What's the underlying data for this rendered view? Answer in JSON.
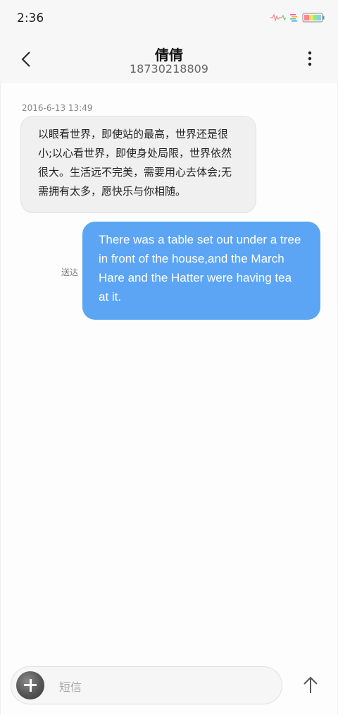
{
  "status_bar": {
    "time": "2:36"
  },
  "header": {
    "name": "倩倩",
    "number": "18730218809"
  },
  "messages": {
    "incoming": {
      "timestamp": "2016-6-13 13:49",
      "text": "以眼看世界，即使站的最高，世界还是很小;以心看世界，即使身处局限，世界依然很大。生活远不完美，需要用心去体会;无需拥有太多，愿快乐与你相随。"
    },
    "outgoing": {
      "status": "送达",
      "text": "There was a table set out under a tree in front of the house,and the March Hare and the Hatter were having tea at it."
    }
  },
  "composer": {
    "placeholder": "短信"
  },
  "icons": {
    "back": "chevron-left-icon",
    "menu": "more-vertical-icon",
    "add": "plus-icon",
    "send": "arrow-up-icon"
  },
  "colors": {
    "outgoing_bubble": "#5ca5f5",
    "incoming_bubble": "#f0f0f0"
  }
}
